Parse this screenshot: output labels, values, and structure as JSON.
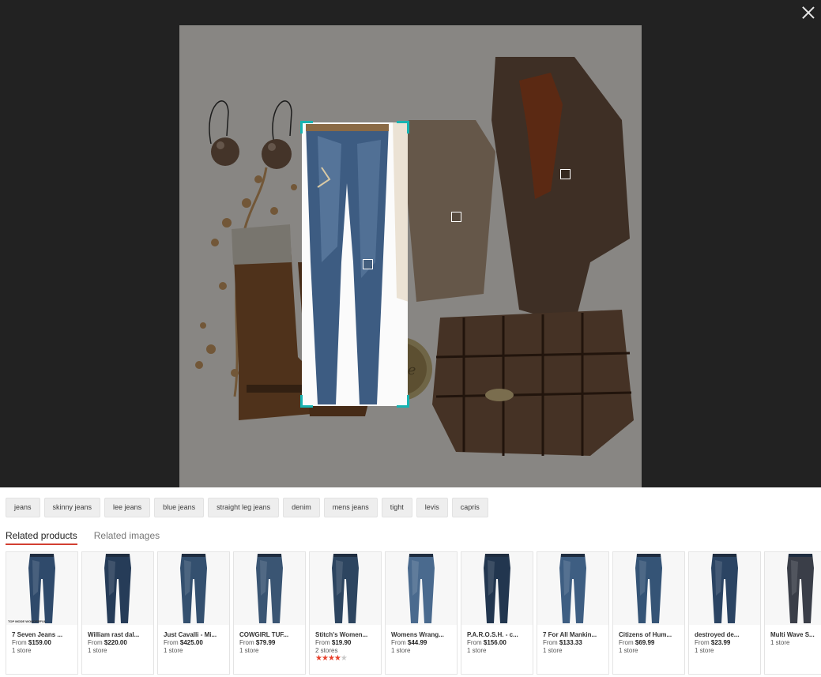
{
  "close_label": "×",
  "chips": [
    "jeans",
    "skinny jeans",
    "lee jeans",
    "blue jeans",
    "straight leg jeans",
    "denim",
    "mens jeans",
    "tight",
    "levis",
    "capris"
  ],
  "tabs": {
    "products": "Related products",
    "images": "Related images"
  },
  "colors": {
    "selection_corner": "#17b3b1",
    "tab_underline": "#d23f31",
    "star_on": "#e8412c",
    "backdrop": "#222222"
  },
  "image_text": "love",
  "products": [
    {
      "name": "7 Seven Jeans ...",
      "price_prefix": "From",
      "price": "$159.00",
      "stores": "1 store",
      "thumb_text": "TOP MODE WONDERFUL"
    },
    {
      "name": "William rast dal...",
      "price_prefix": "From",
      "price": "$220.00",
      "stores": "1 store"
    },
    {
      "name": "Just Cavalli - Mi...",
      "price_prefix": "From",
      "price": "$425.00",
      "stores": "1 store"
    },
    {
      "name": "COWGIRL TUF...",
      "price_prefix": "From",
      "price": "$79.99",
      "stores": "1 store"
    },
    {
      "name": "Stitch's Women...",
      "price_prefix": "From",
      "price": "$19.90",
      "stores": "2 stores",
      "rating": 4
    },
    {
      "name": "Womens Wrang...",
      "price_prefix": "From",
      "price": "$44.99",
      "stores": "1 store"
    },
    {
      "name": "P.A.R.O.S.H. - c...",
      "price_prefix": "From",
      "price": "$156.00",
      "stores": "1 store"
    },
    {
      "name": "7 For All Mankin...",
      "price_prefix": "From",
      "price": "$133.33",
      "stores": "1 store"
    },
    {
      "name": "Citizens of Hum...",
      "price_prefix": "From",
      "price": "$69.99",
      "stores": "1 store"
    },
    {
      "name": "destroyed de...",
      "price_prefix": "From",
      "price": "$23.99",
      "stores": "1 store"
    },
    {
      "name": "Multi Wave S...",
      "price_prefix": "",
      "price": "",
      "stores": "1 store"
    }
  ]
}
